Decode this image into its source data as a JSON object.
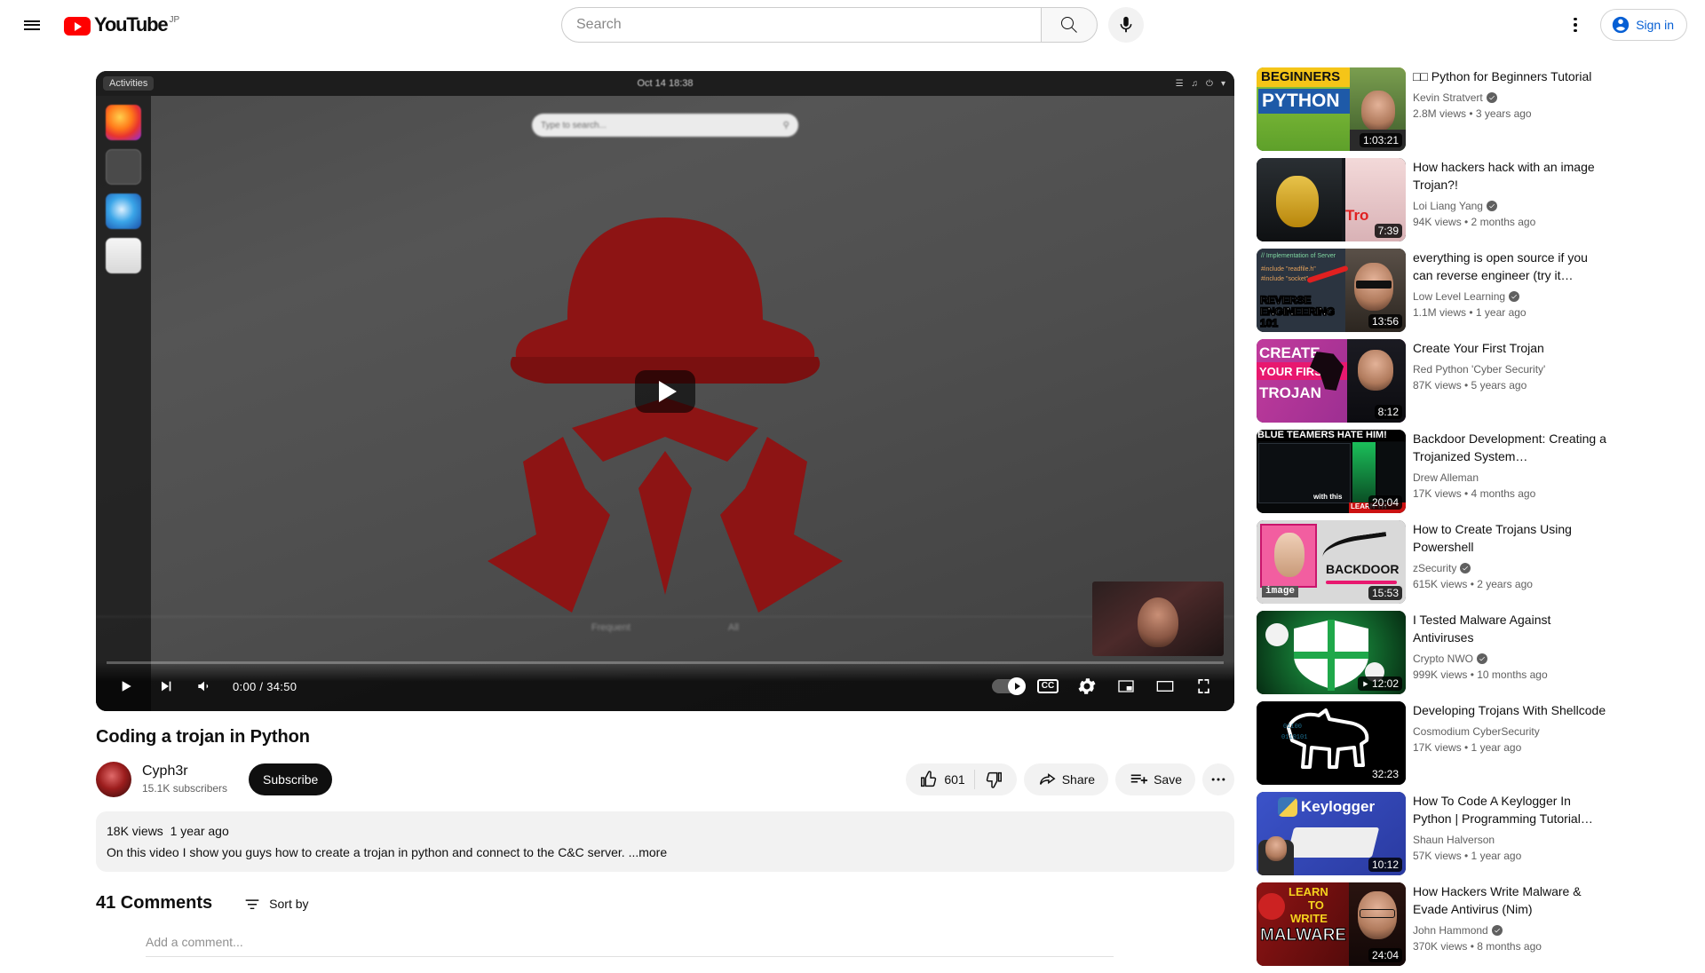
{
  "masthead": {
    "menu_icon": "hamburger-icon",
    "logo_text": "YouTube",
    "logo_country": "JP",
    "search_placeholder": "Search",
    "search_value": "",
    "search_icon": "search-icon",
    "mic_icon": "microphone-icon",
    "kebab_icon": "more-vertical-icon",
    "sign_in_label": "Sign in",
    "accent_blue": "#065fd4",
    "brand_red": "#ff0000"
  },
  "player": {
    "current_time": "0:00",
    "duration": "34:50",
    "time_display": "0:00 / 34:50",
    "play_icon": "play-icon",
    "next_icon": "next-track-icon",
    "volume_icon": "volume-icon",
    "autoplay_icon": "autoplay-toggle",
    "captions_label": "CC",
    "settings_icon": "gear-icon",
    "miniplayer_icon": "miniplayer-icon",
    "theater_icon": "theater-mode-icon",
    "fullscreen_icon": "fullscreen-icon",
    "big_play_icon": "large-play-button",
    "progress_percent": 0,
    "video_frame": {
      "os_topbar_activities": "Activities",
      "os_topbar_clock": "Oct 14 18:38",
      "os_search_placeholder": "Type to search...",
      "bottom_left_label": "Frequent",
      "bottom_right_label": "All"
    }
  },
  "video": {
    "title": "Coding a trojan in Python",
    "channel_name": "Cyph3r",
    "channel_subscribers": "15.1K subscribers",
    "subscribe_label": "Subscribe",
    "like_count": "601",
    "like_icon": "thumbs-up-icon",
    "dislike_icon": "thumbs-down-icon",
    "share_label": "Share",
    "share_icon": "share-icon",
    "save_label": "Save",
    "save_icon": "save-to-playlist-icon",
    "more_icon": "more-horizontal-icon",
    "views": "18K views",
    "published": "1 year ago",
    "description": "On this video I show you guys how to create a trojan in python and connect to the C&C server.",
    "more_label": "...more"
  },
  "comments": {
    "count_label": "41 Comments",
    "sort_label": "Sort by",
    "sort_icon": "sort-icon",
    "add_placeholder": "Add a comment..."
  },
  "suggestions": [
    {
      "title": "□□ Python for Beginners Tutorial",
      "channel": "Kevin Stratvert",
      "verified": true,
      "views": "2.8M views",
      "age": "3 years ago",
      "meta": "2.8M views  •  3 years ago",
      "duration": "1:03:21",
      "watched": false
    },
    {
      "title": "How hackers hack with an image Trojan?!",
      "channel": "Loi Liang Yang",
      "verified": true,
      "views": "94K views",
      "age": "2 months ago",
      "meta": "94K views  •  2 months ago",
      "duration": "7:39",
      "watched": false
    },
    {
      "title": "everything is open source if you can reverse engineer (try it…",
      "channel": "Low Level Learning",
      "verified": true,
      "views": "1.1M views",
      "age": "1 year ago",
      "meta": "1.1M views  •  1 year ago",
      "duration": "13:56",
      "watched": false
    },
    {
      "title": "Create Your First Trojan",
      "channel": "Red Python 'Cyber Security'",
      "verified": false,
      "views": "87K views",
      "age": "5 years ago",
      "meta": "87K views  •  5 years ago",
      "duration": "8:12",
      "watched": false
    },
    {
      "title": "Backdoor Development: Creating a Trojanized System…",
      "channel": "Drew Alleman",
      "verified": false,
      "views": "17K views",
      "age": "4 months ago",
      "meta": "17K views  •  4 months ago",
      "duration": "20:04",
      "watched": false
    },
    {
      "title": "How to Create Trojans Using Powershell",
      "channel": "zSecurity",
      "verified": true,
      "views": "615K views",
      "age": "2 years ago",
      "meta": "615K views  •  2 years ago",
      "duration": "15:53",
      "watched": false
    },
    {
      "title": "I Tested Malware Against Antiviruses",
      "channel": "Crypto NWO",
      "verified": true,
      "views": "999K views",
      "age": "10 months ago",
      "meta": "999K views  •  10 months ago",
      "duration": "12:02",
      "watched": true
    },
    {
      "title": "Developing Trojans With Shellcode",
      "channel": "Cosmodium CyberSecurity",
      "verified": false,
      "views": "17K views",
      "age": "1 year ago",
      "meta": "17K views  •  1 year ago",
      "duration": "32:23",
      "watched": false
    },
    {
      "title": "How To Code A Keylogger In Python | Programming Tutorial…",
      "channel": "Shaun Halverson",
      "verified": false,
      "views": "57K views",
      "age": "1 year ago",
      "meta": "57K views  •  1 year ago",
      "duration": "10:12",
      "watched": false
    },
    {
      "title": "How Hackers Write Malware & Evade Antivirus (Nim)",
      "channel": "John Hammond",
      "verified": true,
      "views": "370K views",
      "age": "8 months ago",
      "meta": "370K views  •  8 months ago",
      "duration": "24:04",
      "watched": false
    }
  ]
}
